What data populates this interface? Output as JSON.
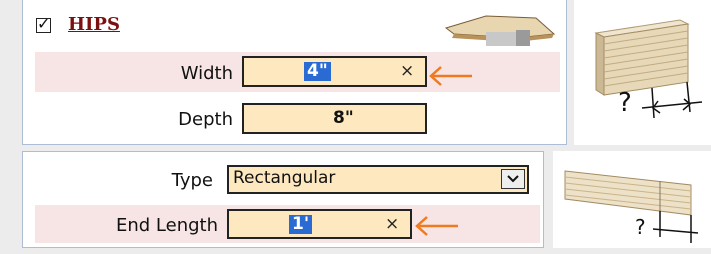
{
  "hips": {
    "enabled_label": "HIPS",
    "width": {
      "label": "Width",
      "value": "4\"",
      "clear": "×"
    },
    "depth": {
      "label": "Depth",
      "value": "8\""
    },
    "colors": {
      "band": "#f7e5e5",
      "field": "#fde8bf",
      "selection": "#2a6ad3",
      "label_dark_red": "#7b1010"
    }
  },
  "end": {
    "type": {
      "label": "Type",
      "value": "Rectangular"
    },
    "end_length": {
      "label": "End Length",
      "value": "1'",
      "clear": "×"
    }
  },
  "thumbnails": {
    "depth_mark": "?",
    "length_mark": "?"
  },
  "annotations": {
    "arrow_color": "#f07a1e"
  }
}
